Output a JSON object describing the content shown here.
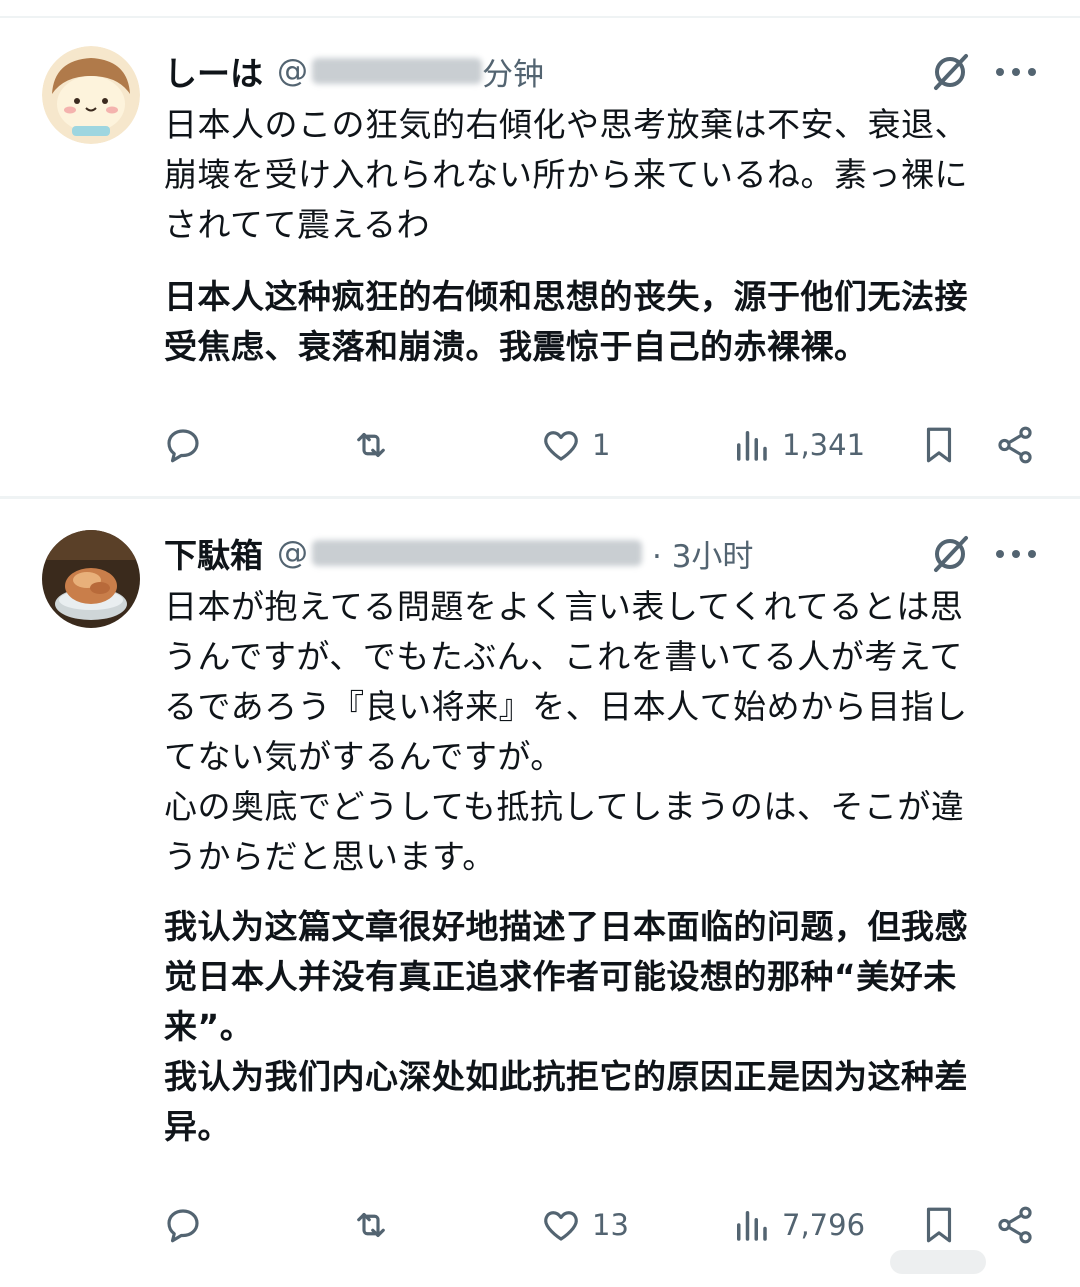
{
  "tweets": [
    {
      "name": "しーは",
      "handle": "@",
      "time": "分钟",
      "text": "日本人のこの狂気的右傾化や思考放棄は不安、衰退、\n崩壊を受け入れられない所から来ているね。素っ裸に\nされてて震えるわ",
      "translation": "日本人这种疯狂的右倾和思想的丧失，源于他们无法接\n受焦虑、衰落和崩溃。我震惊于自己的赤裸裸。",
      "likes": "1",
      "views": "1,341"
    },
    {
      "name": "下駄箱",
      "handle": "@",
      "time": "· 3小时",
      "text": "日本が抱えてる問題をよく言い表してくれてるとは思\nうんですが、でもたぶん、これを書いてる人が考えて\nるであろう『良い将来』を、日本人て始めから目指し\nてない気がするんですが。\n心の奥底でどうしても抵抗してしまうのは、そこが違\nうからだと思います。",
      "translation": "我认为这篇文章很好地描述了日本面临的问题，但我感\n觉日本人并没有真正追求作者可能设想的那种“美好未\n来”。\n我认为我们内心深处如此抗拒它的原因正是因为这种差\n异。",
      "likes": "13",
      "views": "7,796"
    }
  ],
  "icons": {
    "reply": "reply-icon",
    "retweet": "retweet-icon",
    "like": "heart-icon",
    "views": "views-icon",
    "bookmark": "bookmark-icon",
    "share": "share-icon",
    "grok": "grok-icon",
    "more": "more-icon"
  },
  "colors": {
    "text": "#0f1419",
    "secondary": "#536471",
    "separator": "#eff3f4"
  }
}
